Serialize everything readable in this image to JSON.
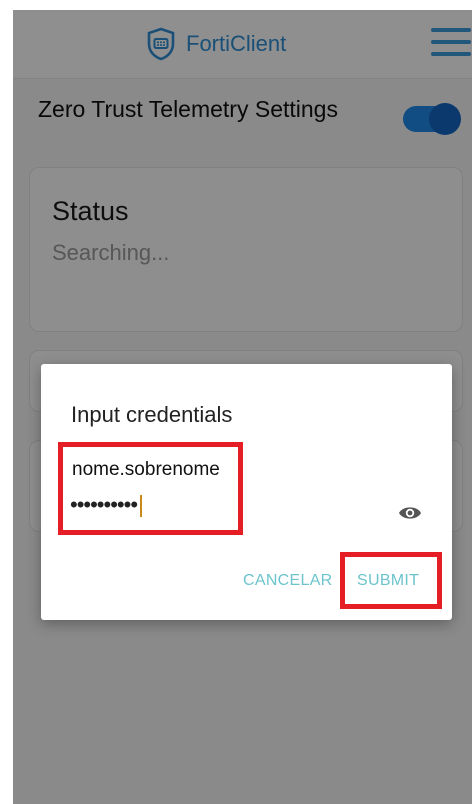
{
  "app": {
    "name": "FortiClient"
  },
  "settings": {
    "zero_trust_label": "Zero Trust Telemetry Settings",
    "zero_trust_enabled": true
  },
  "status": {
    "title": "Status",
    "value": "Searching..."
  },
  "dialog": {
    "title": "Input credentials",
    "username": "nome.sobrenome",
    "password_masked": "••••••••••",
    "cancel_label": "CANCELAR",
    "submit_label": "SUBMIT"
  },
  "icons": {
    "logo": "forticlient-shield-icon",
    "menu": "hamburger-menu-icon",
    "visibility": "eye-icon"
  },
  "colors": {
    "brand": "#2f8dd1",
    "toggle": "#1e88e5",
    "highlight": "#e51e25",
    "button_text": "#6cc4cc"
  }
}
